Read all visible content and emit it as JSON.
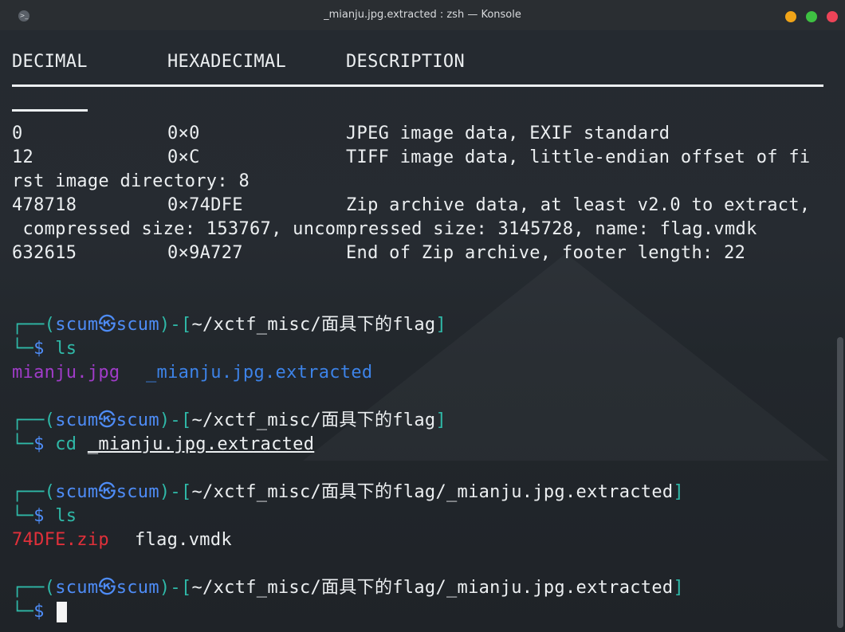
{
  "window": {
    "title": "_mianju.jpg.extracted : zsh — Konsole"
  },
  "binwalk": {
    "headers": [
      "DECIMAL",
      "HEXADECIMAL",
      "DESCRIPTION"
    ],
    "rows": [
      {
        "dec": "0",
        "hex": "0×0",
        "desc": "JPEG image data, EXIF standard"
      },
      {
        "dec": "12",
        "hex": "0×C",
        "desc": "TIFF image data, little-endian offset of fi"
      },
      {
        "cont": "rst image directory: 8"
      },
      {
        "dec": "478718",
        "hex": "0×74DFE",
        "desc": "Zip archive data, at least v2.0 to extract,"
      },
      {
        "cont": " compressed size: 153767, uncompressed size: 3145728, name: flag.vmdk"
      },
      {
        "dec": "632615",
        "hex": "0×9A727",
        "desc": "End of Zip archive, footer length: 22"
      }
    ]
  },
  "prompt": {
    "corner_top": "┌──",
    "corner_bottom": "└─",
    "open_paren": "(",
    "user": "scum",
    "at": "㉿",
    "host": "scum",
    "close_paren": ")",
    "dash": "-",
    "dollar": "$"
  },
  "blocks": [
    {
      "cwd": "~/xctf_misc/面具下的flag",
      "cmd": "ls",
      "arg": ""
    },
    {
      "cwd": "~/xctf_misc/面具下的flag",
      "cmd": "cd",
      "arg": "_mianju.jpg.extracted"
    },
    {
      "cwd": "~/xctf_misc/面具下的flag/_mianju.jpg.extracted",
      "cmd": "ls",
      "arg": ""
    },
    {
      "cwd": "~/xctf_misc/面具下的flag/_mianju.jpg.extracted",
      "cmd": "",
      "arg": ""
    }
  ],
  "outputs": {
    "ls1": [
      "mianju.jpg",
      "_mianju.jpg.extracted"
    ],
    "ls2": [
      "74DFE.zip",
      "flag.vmdk"
    ]
  }
}
